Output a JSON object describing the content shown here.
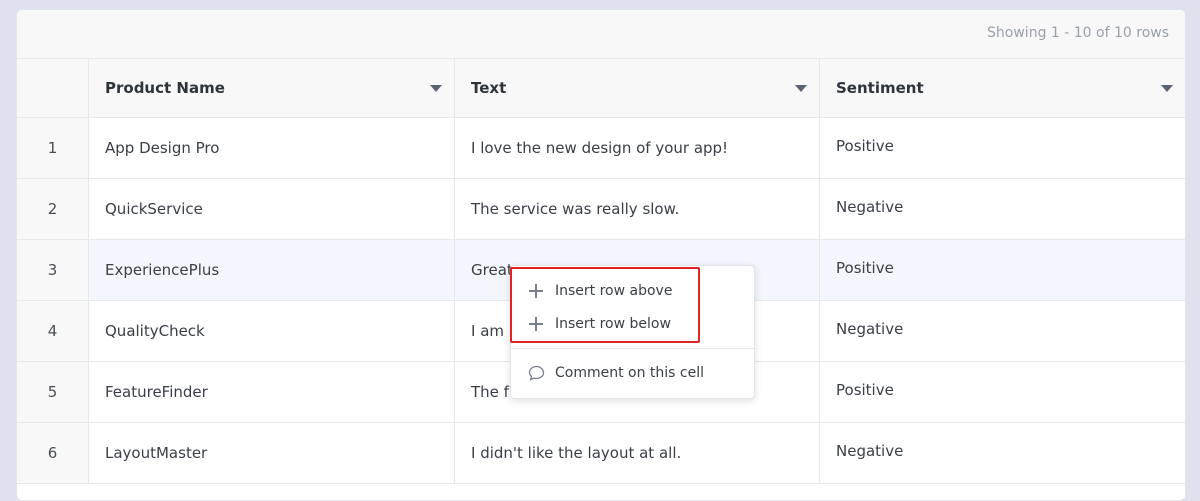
{
  "toolbar": {
    "row_count": "Showing 1 - 10 of 10 rows"
  },
  "table": {
    "columns": [
      "Product Name",
      "Text",
      "Sentiment"
    ],
    "rows": [
      {
        "num": "1",
        "product": "App Design Pro",
        "text": "I love the new design of your app!",
        "sentiment": "Positive"
      },
      {
        "num": "2",
        "product": "QuickService",
        "text": "The service was really slow.",
        "sentiment": "Negative"
      },
      {
        "num": "3",
        "product": "ExperiencePlus",
        "text": "Great",
        "sentiment": "Positive"
      },
      {
        "num": "4",
        "product": "QualityCheck",
        "text": "I am",
        "sentiment": "Negative"
      },
      {
        "num": "5",
        "product": "FeatureFinder",
        "text": "The f",
        "sentiment": "Positive"
      },
      {
        "num": "6",
        "product": "LayoutMaster",
        "text": "I didn't like the layout at all.",
        "sentiment": "Negative"
      }
    ]
  },
  "context_menu": {
    "items": [
      {
        "label": "Insert row above",
        "icon": "plus-icon"
      },
      {
        "label": "Insert row below",
        "icon": "plus-icon"
      },
      {
        "label": "Comment on this cell",
        "icon": "comment-icon"
      }
    ]
  },
  "colors": {
    "highlight_border": "#e02424",
    "selected_row": "#f3f6fc",
    "background": "#dde2ee"
  }
}
